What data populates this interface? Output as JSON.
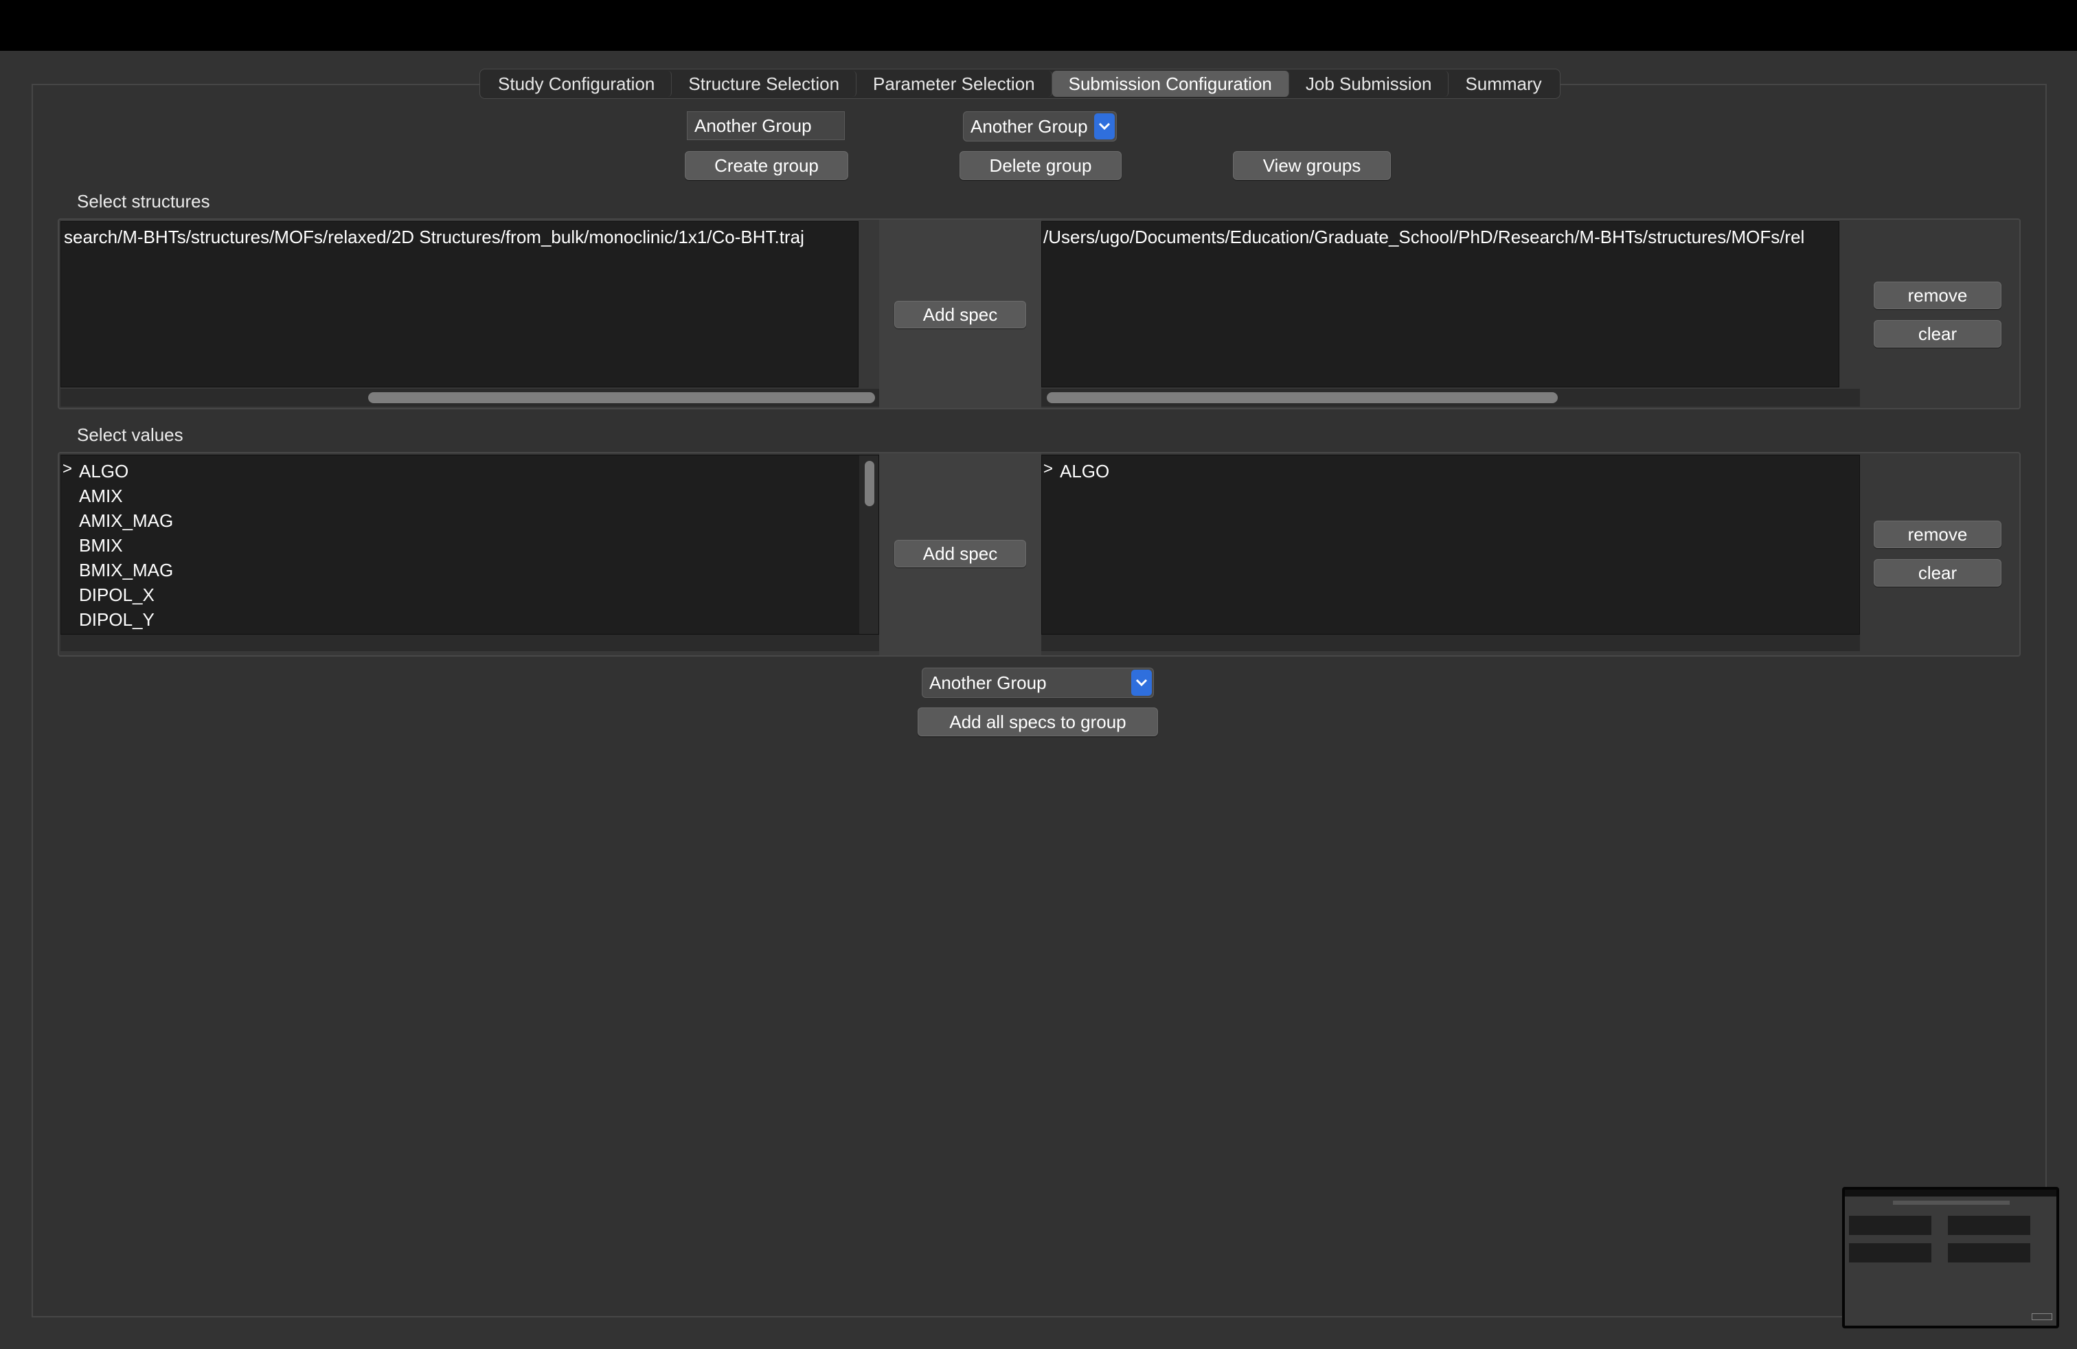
{
  "tabs": [
    {
      "label": "Study Configuration"
    },
    {
      "label": "Structure Selection"
    },
    {
      "label": "Parameter Selection"
    },
    {
      "label": "Submission Configuration"
    },
    {
      "label": "Job Submission"
    },
    {
      "label": "Summary"
    }
  ],
  "selected_tab": "Submission Configuration",
  "groups": {
    "name_input_value": "Another Group",
    "select_value": "Another Group",
    "create_label": "Create group",
    "delete_label": "Delete group",
    "view_label": "View groups"
  },
  "structures": {
    "label": "Select structures",
    "available_path": "search/M-BHTs/structures/MOFs/relaxed/2D Structures/from_bulk/monoclinic/1x1/Co-BHT.traj",
    "add_label": "Add spec",
    "selected_path": "/Users/ugo/Documents/Education/Graduate_School/PhD/Research/M-BHTs/structures/MOFs/rel",
    "remove_label": "remove",
    "clear_label": "clear"
  },
  "values": {
    "label": "Select values",
    "items": [
      "ALGO",
      "AMIX",
      "AMIX_MAG",
      "BMIX",
      "BMIX_MAG",
      "DIPOL_X",
      "DIPOL_Y"
    ],
    "add_label": "Add spec",
    "selected_items": [
      "ALGO"
    ],
    "remove_label": "remove",
    "clear_label": "clear"
  },
  "bottom": {
    "group_select_value": "Another Group",
    "add_all_label": "Add all specs to group"
  },
  "colors": {
    "accent": "#2f6fdd",
    "background": "#333333",
    "list_background": "#1e1e1e"
  }
}
